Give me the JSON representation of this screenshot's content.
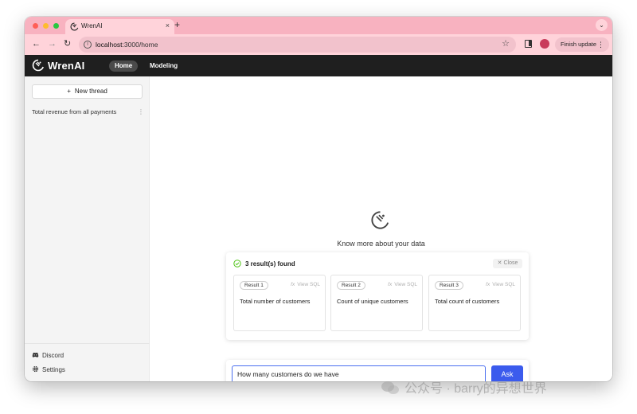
{
  "browser": {
    "tab_title": "WrenAI",
    "tab_close": "×",
    "new_tab": "+",
    "tab_menu": "⌄",
    "url_host": "localhost",
    "url_path": ":3000/home",
    "finish_update_label": "Finish update",
    "kebab": "⋮",
    "back": "←",
    "forward": "→",
    "reload": "↻",
    "star": "☆",
    "info": "i"
  },
  "app": {
    "logo_text": "WrenAI",
    "nav": {
      "home": "Home",
      "modeling": "Modeling"
    }
  },
  "sidebar": {
    "new_thread_label": "New thread",
    "new_thread_plus": "+",
    "threads": [
      {
        "label": "Total revenue from all payments",
        "more": "⋮"
      }
    ],
    "discord_label": "Discord",
    "settings_label": "Settings"
  },
  "main": {
    "hero_text": "Know more about your data",
    "results": {
      "count_label": "3 result(s) found",
      "close_label": "Close",
      "close_x": "✕",
      "view_sql_label": "View SQL",
      "fx": "fx",
      "items": [
        {
          "badge": "Result 1",
          "text": "Total number of customers"
        },
        {
          "badge": "Result 2",
          "text": "Count of unique customers"
        },
        {
          "badge": "Result 3",
          "text": "Total count of customers"
        }
      ]
    },
    "ask": {
      "input_value": "How many customers do we have",
      "button_label": "Ask"
    }
  },
  "watermark": {
    "text": "公众号 · barry的异想世界"
  },
  "colors": {
    "tab_strip": "#f8b2c0",
    "toolbar": "#ffd3da",
    "header": "#1f1f1f",
    "accent": "#3b5bed",
    "success": "#52c41a",
    "profile": "#c93b5b"
  }
}
